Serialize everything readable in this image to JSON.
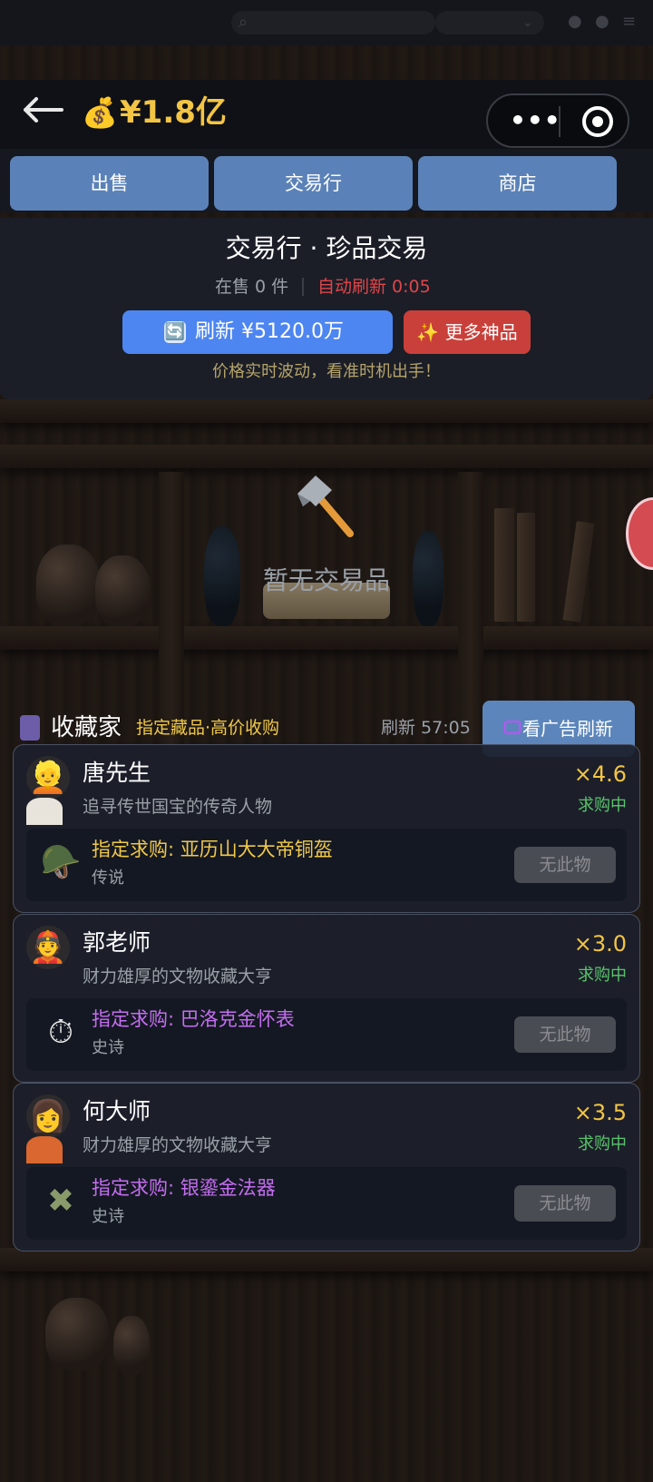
{
  "header": {
    "back_icon": "arrow-left-icon",
    "balance_icon": "💰",
    "balance": "¥1.8亿",
    "capsule_more": "•••",
    "capsule_close_icon": "target-icon"
  },
  "tabs": [
    {
      "label": "出售"
    },
    {
      "label": "交易行"
    },
    {
      "label": "商店"
    }
  ],
  "market": {
    "title": "交易行 · 珍品交易",
    "on_sale": "在售 0 件",
    "auto_refresh": "自动刷新 0:05",
    "refresh_icon": "🔄",
    "refresh_label": "刷新 ¥5120.0万",
    "more_label": "✨ 更多神品",
    "tip": "价格实时波动，看准时机出手！"
  },
  "empty": {
    "icon": "hammer-icon",
    "text": "暂无交易品"
  },
  "collectors": {
    "title": "收藏家",
    "subtitle": "指定藏品·高价收购",
    "refresh_timer": "刷新 57:05",
    "ad_refresh_label": "看广告刷新",
    "no_item_label": "无此物",
    "items": [
      {
        "name": "唐先生",
        "avatar": "👱",
        "desc": "追寻传世国宝的传奇人物",
        "multiplier": "×4.6",
        "status": "求购中",
        "request": "指定求购: 亚历山大大帝铜盔",
        "rarity": "传说",
        "rarity_color": "#f0c94a",
        "item_icon": "🪖"
      },
      {
        "name": "郭老师",
        "avatar": "👲",
        "desc": "财力雄厚的文物收藏大亨",
        "multiplier": "×3.0",
        "status": "求购中",
        "request": "指定求购: 巴洛克金怀表",
        "rarity": "史诗",
        "rarity_color": "#c46ef0",
        "item_icon": "⏱"
      },
      {
        "name": "何大师",
        "avatar": "👩",
        "desc": "财力雄厚的文物收藏大亨",
        "multiplier": "×3.5",
        "status": "求购中",
        "request": "指定求购: 银鎏金法器",
        "rarity": "史诗",
        "rarity_color": "#c46ef0",
        "item_icon": "✖"
      }
    ]
  },
  "colors": {
    "gold": "#f3c544",
    "tab_blue": "#5b82b8",
    "refresh_blue": "#4d86f0",
    "danger_red": "#c9403a",
    "status_green": "#5ac46b"
  }
}
